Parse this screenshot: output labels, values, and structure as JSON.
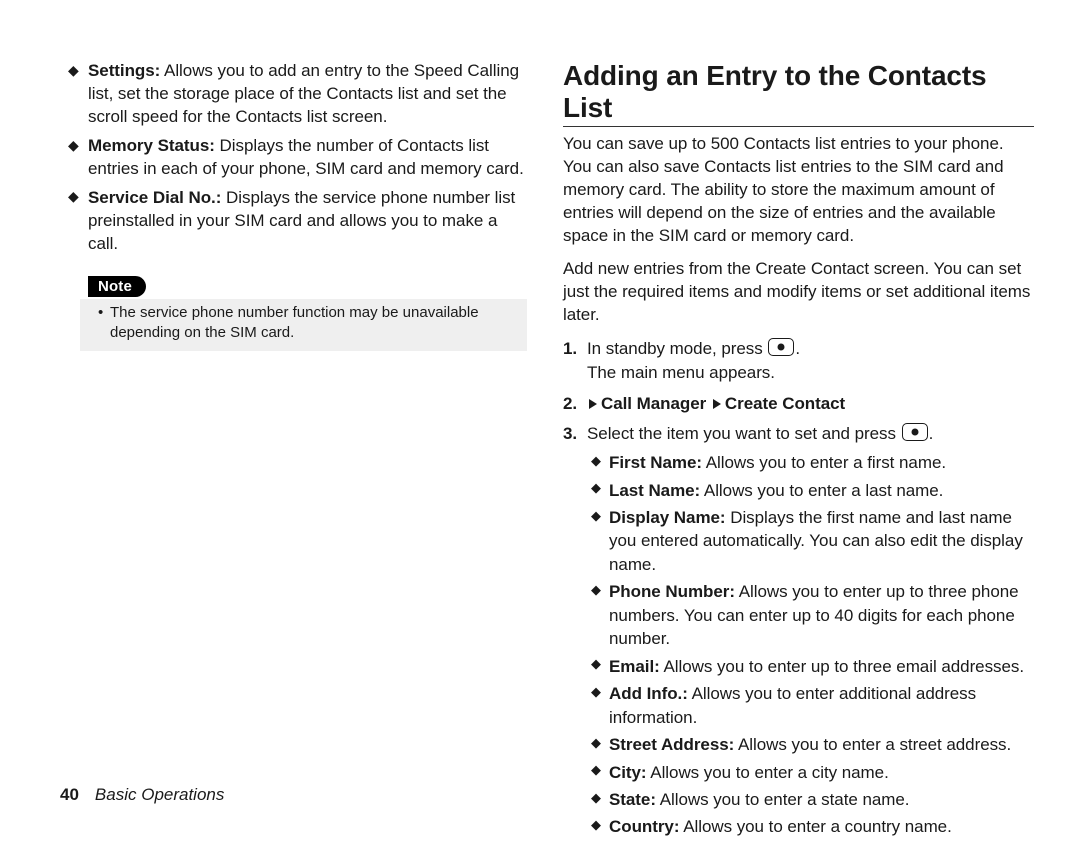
{
  "leftList": [
    {
      "term": "Settings:",
      "text": " Allows you to add an entry to the Speed Calling list, set the storage place of the Contacts list and set the scroll speed for the Contacts list screen."
    },
    {
      "term": "Memory Status:",
      "text": " Displays the number of Contacts list entries in each of your phone, SIM card and memory card."
    },
    {
      "term": "Service Dial No.:",
      "text": " Displays the service phone number list preinstalled in your SIM card and allows you to make a call."
    }
  ],
  "note": {
    "label": "Note",
    "text": "The service phone number function may be unavailable depending on the SIM card."
  },
  "sectionTitle": "Adding an Entry to the Contacts List",
  "paras": [
    "You can save up to 500 Contacts list entries to your phone. You can also save Contacts list entries to the SIM card and memory card. The ability to store the maximum amount of entries will depend on the size of entries and the available space in the SIM card or memory card.",
    "Add new entries from the Create Contact screen. You can set just the required items and modify items or set additional items later."
  ],
  "steps": {
    "s1a": "In standby mode, press ",
    "s1b": ".",
    "s1c": "The main menu appears.",
    "s2a": "Call Manager",
    "s2b": "Create Contact",
    "s3a": "Select the item you want to set and press ",
    "s3b": "."
  },
  "fields": [
    {
      "term": "First Name:",
      "text": " Allows you to enter a first name."
    },
    {
      "term": "Last Name:",
      "text": " Allows you to enter a last name."
    },
    {
      "term": "Display Name:",
      "text": " Displays the first name and last name you entered automatically. You can also edit the display name."
    },
    {
      "term": "Phone Number:",
      "text": " Allows you to enter up to three phone numbers. You can enter up to 40 digits for each phone number."
    },
    {
      "term": "Email:",
      "text": " Allows you to enter up to three email addresses."
    },
    {
      "term": "Add Info.:",
      "text": " Allows you to enter additional address information."
    },
    {
      "term": "Street Address:",
      "text": " Allows you to enter a street address."
    },
    {
      "term": "City:",
      "text": " Allows you to enter a city name."
    },
    {
      "term": "State:",
      "text": " Allows you to enter a state name."
    },
    {
      "term": "Country:",
      "text": " Allows you to enter a country name."
    }
  ],
  "footer": {
    "page": "40",
    "chapter": "Basic Operations"
  }
}
